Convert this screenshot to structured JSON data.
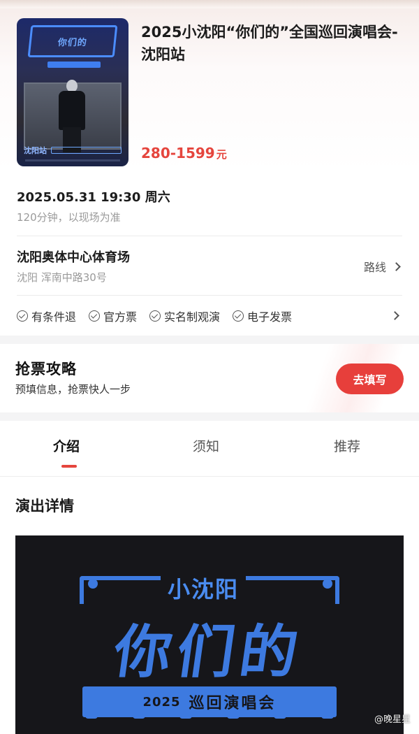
{
  "event": {
    "title": "2025小沈阳“你们的”全国巡回演唱会-沈阳站",
    "price": "280-1599",
    "price_unit": "元",
    "poster": {
      "title_text": "你们的",
      "city": "沈阳站"
    }
  },
  "schedule": {
    "datetime": "2025.05.31 19:30 周六",
    "duration": "120分钟，以现场为准"
  },
  "venue": {
    "name": "沈阳奥体中心体育场",
    "address": "沈阳 浑南中路30号",
    "route_label": "路线"
  },
  "features": [
    "有条件退",
    "官方票",
    "实名制观演",
    "电子发票"
  ],
  "ticket_guide": {
    "title": "抢票攻略",
    "subtitle": "预填信息，抢票快人一步",
    "button_label": "去填写"
  },
  "tabs": [
    {
      "label": "介绍",
      "active": true
    },
    {
      "label": "须知",
      "active": false
    },
    {
      "label": "推荐",
      "active": false
    }
  ],
  "details": {
    "section_title": "演出详情",
    "banner": {
      "subtitle": "小沈阳",
      "main_title": "你们的",
      "year": "2025",
      "tour": "巡回演唱会"
    }
  },
  "watermark": "@晚星星",
  "colors": {
    "accent_red": "#e5453d",
    "button_red": "#e73f3b",
    "banner_blue": "#3d7ae0"
  }
}
